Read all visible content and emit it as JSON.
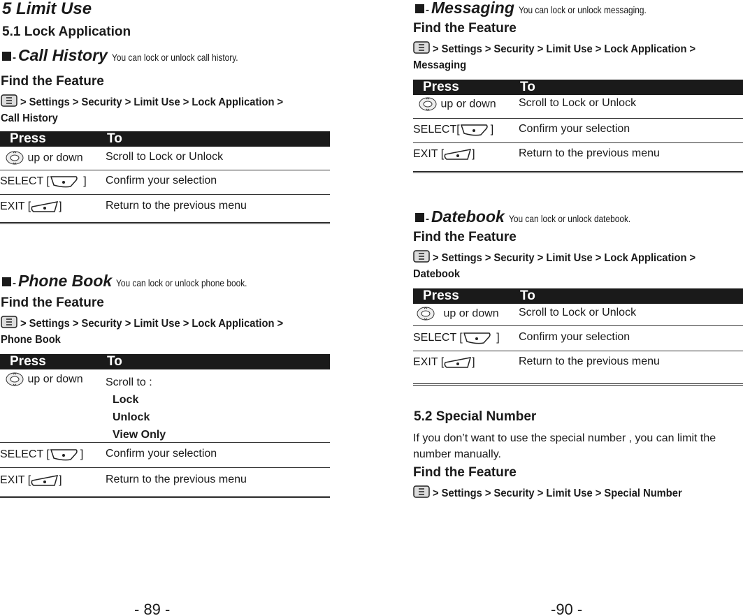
{
  "left": {
    "chapter": "5 Limit Use",
    "section": "5.1 Lock Application",
    "call_history": {
      "name": "Call History",
      "desc": "You can lock or unlock call history.",
      "find": "Find the Feature",
      "path": "> Settings > Security > Limit Use > Lock Application >",
      "path_end": "Call History",
      "header": {
        "press": "Press",
        "to": "To"
      },
      "rows": [
        {
          "press": "up or down",
          "to": "Scroll to Lock or Unlock"
        },
        {
          "press": "SELECT  [",
          "press_end": "]",
          "to": "Confirm your selection"
        },
        {
          "press": "EXIT [",
          "press_end": "]",
          "to": "Return to the previous menu"
        }
      ]
    },
    "phone_book": {
      "name": "Phone Book",
      "desc": "You can lock or unlock phone book.",
      "find": "Find the Feature",
      "path": "> Settings > Security > Limit Use > Lock Application >",
      "path_end": "Phone Book",
      "header": {
        "press": "Press",
        "to": "To"
      },
      "rows": [
        {
          "press": "up or down",
          "to": "Scroll to :",
          "options": [
            "Lock",
            "Unlock",
            "View Only"
          ]
        },
        {
          "press": "SELECT [",
          "press_end": "]",
          "to": "Confirm your selection"
        },
        {
          "press": "EXIT [",
          "press_end": "]",
          "to": "Return to the previous menu"
        }
      ]
    },
    "page_number": "- 89 -"
  },
  "right": {
    "messaging": {
      "name": "Messaging",
      "desc": "You can lock or unlock messaging.",
      "find": "Find the Feature",
      "path": "> Settings > Security > Limit Use > Lock Application >",
      "path_end": "Messaging",
      "header": {
        "press": "Press",
        "to": "To"
      },
      "rows": [
        {
          "press": "up or down",
          "to": "Scroll to Lock or Unlock"
        },
        {
          "press": "SELECT[",
          "press_end": "]",
          "to": "Confirm your selection"
        },
        {
          "press": "EXIT [",
          "press_end": "]",
          "to": "Return to the previous menu"
        }
      ]
    },
    "datebook": {
      "name": "Datebook",
      "desc": "You can lock or unlock datebook.",
      "find": "Find the Feature",
      "path": "> Settings > Security > Limit Use > Lock Application >",
      "path_end": "Datebook",
      "header": {
        "press": "Press",
        "to": "To"
      },
      "rows": [
        {
          "press": "up or down",
          "to": "Scroll to Lock or Unlock"
        },
        {
          "press": "SELECT [",
          "press_end": "]",
          "to": "Confirm your selection"
        },
        {
          "press": "EXIT [",
          "press_end": "]",
          "to": "Return to the previous menu"
        }
      ]
    },
    "special": {
      "title": "5.2 Special Number",
      "text": "If you don’t want  to use the special number , you can limit the number manually.",
      "find": "Find the Feature",
      "path": "> Settings > Security > Limit Use >  Special Number"
    },
    "page_number": "-90 -"
  },
  "icons": {
    "menu": "menu-key-icon",
    "nav": "navigation-key-icon",
    "select": "left-softkey-icon",
    "exit": "right-softkey-icon"
  }
}
